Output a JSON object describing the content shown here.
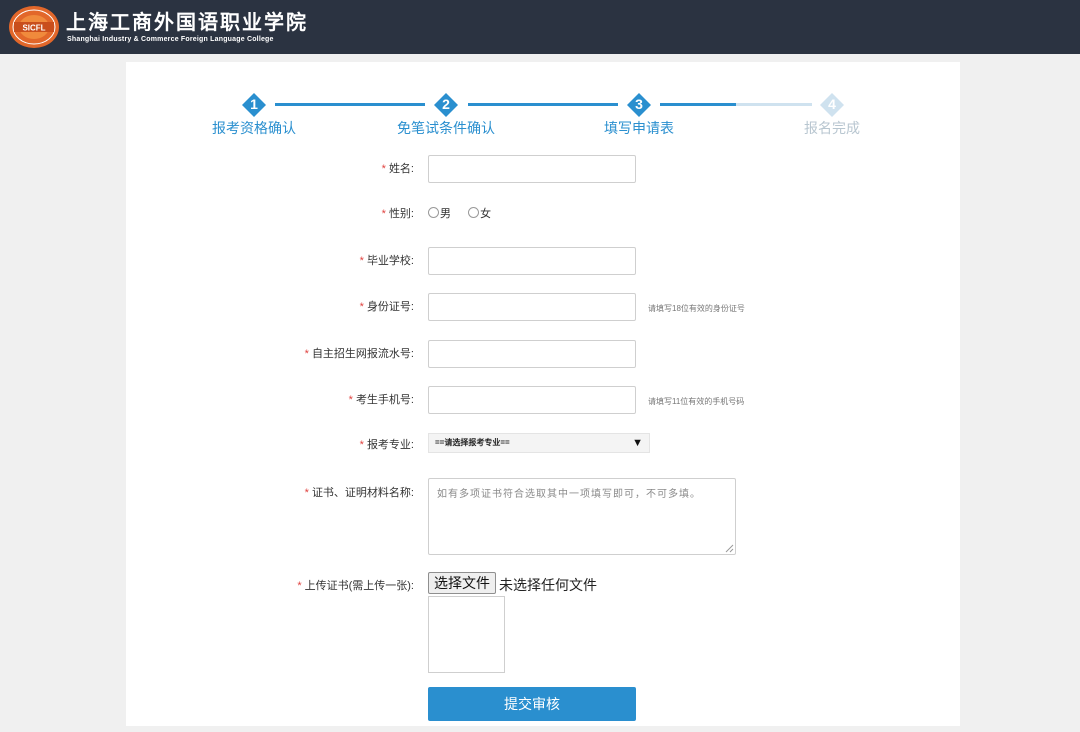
{
  "header": {
    "logo_abbr": "SICFL",
    "college_name_cn": "上海工商外国语职业学院",
    "college_name_en": "Shanghai Industry & Commerce Foreign Language College",
    "logo_icon": "college-seal-icon",
    "background_color": "#2b3341"
  },
  "steps": [
    {
      "number": "1",
      "label": "报考资格确认",
      "state": "done"
    },
    {
      "number": "2",
      "label": "免笔试条件确认",
      "state": "done"
    },
    {
      "number": "3",
      "label": "填写申请表",
      "state": "current"
    },
    {
      "number": "4",
      "label": "报名完成",
      "state": "pending"
    }
  ],
  "form": {
    "required_mark": "*",
    "name": {
      "label": "姓名:",
      "value": ""
    },
    "gender": {
      "label": "性别:",
      "options": [
        "男",
        "女"
      ],
      "selected": null
    },
    "school": {
      "label": "毕业学校:",
      "value": ""
    },
    "id_number": {
      "label": "身份证号:",
      "value": "",
      "hint": "请填写18位有效的身份证号"
    },
    "serial_number": {
      "label": "自主招生网报流水号:",
      "value": ""
    },
    "phone": {
      "label": "考生手机号:",
      "value": "",
      "hint": "请填写11位有效的手机号码"
    },
    "major": {
      "label": "报考专业:",
      "selected": "==请选择报考专业=="
    },
    "certificate_name": {
      "label": "证书、证明材料名称:",
      "placeholder": "如有多项证书符合选取其中一项填写即可，不可多填。"
    },
    "upload": {
      "label": "上传证书(需上传一张):",
      "button_label": "选择文件",
      "status": "未选择任何文件"
    },
    "submit_label": "提交审核"
  },
  "colors": {
    "accent": "#2a8fcf",
    "required": "#e0423f",
    "inactive_step": "#cfe2ef"
  }
}
